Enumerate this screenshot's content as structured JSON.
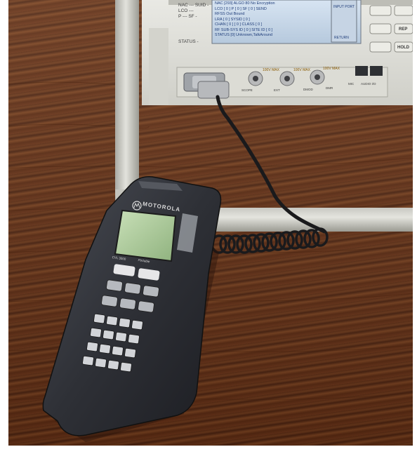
{
  "instrument": {
    "screen_lines": [
      "NAC ---   SUID -",
      "LCO ---",
      "P ---   SF -",
      "STATUS -"
    ],
    "screen_right_lines": [
      "NAC [293] ALGO 80 No Encryption",
      "LCO [ 0 ] P [ 0 ] SF [ 0 ]  SEND",
      "RFSS Out Bound",
      "LRA [ 0 ]  SYSID [ 0 ]",
      "CHAN [ 0 ] [ 0 ]  CLASS [ 0 ]",
      "RF SUB-SYS ID [ 0 ]  SITE ID [ 0 ]",
      "STATUS [0] Unknown,TalkAround"
    ],
    "soft_keys": [
      "INPUT PORT",
      "RETURN"
    ],
    "side_keys": [
      "REP",
      "HOLD"
    ],
    "port_labels": [
      "SCOPE",
      "EXT",
      "DMOD",
      "DMR",
      "MIC",
      "AUDIO I/O"
    ],
    "max_labels": [
      "100V MAX",
      "100V MAX",
      "100V MAX"
    ]
  },
  "device": {
    "brand": "MOTOROLA",
    "model": "CVL 3000",
    "sub_brand": "Portable"
  }
}
